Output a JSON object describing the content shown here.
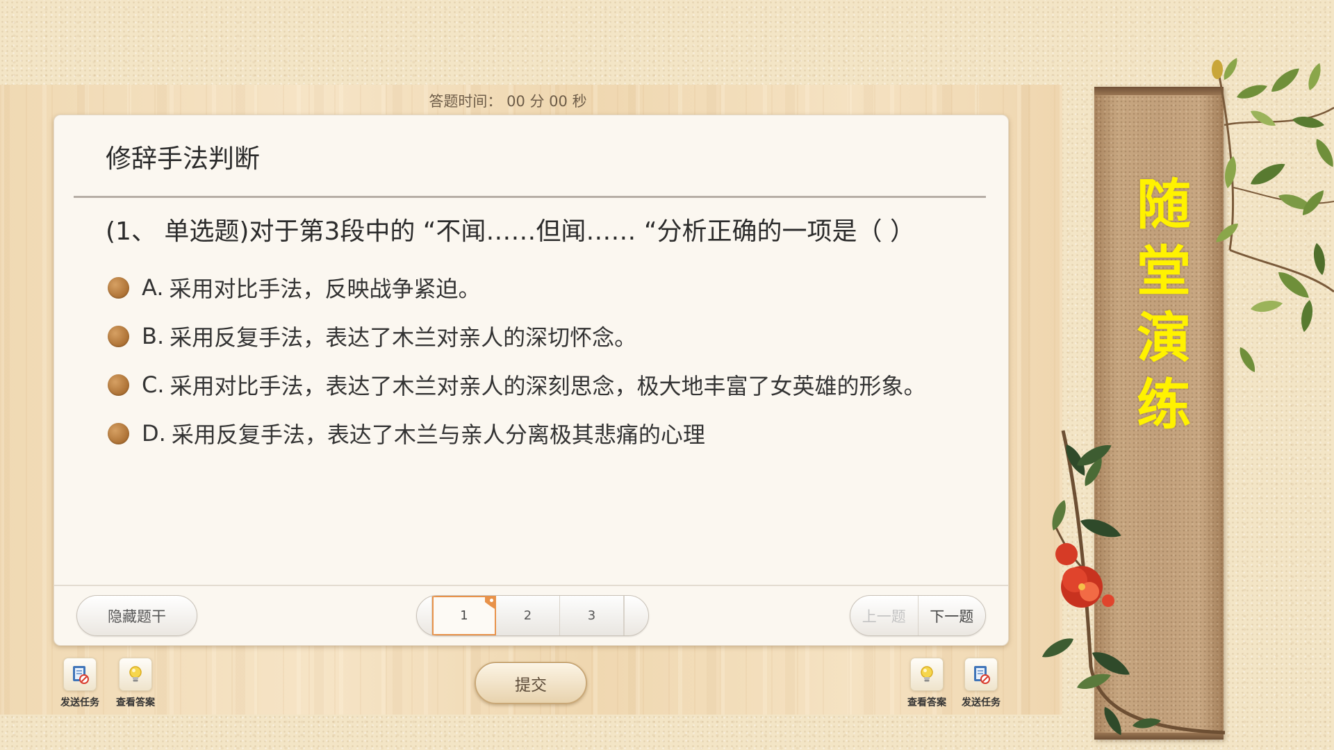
{
  "timer_text": "答题时间： 00 分 00 秒",
  "question": {
    "category": "修辞手法判断",
    "stem": "(1、 单选题)对于第3段中的 “不闻……但闻…… “分析正确的一项是（ ）",
    "options": [
      {
        "letter": "A.",
        "text": "采用对比手法，反映战争紧迫。"
      },
      {
        "letter": "B.",
        "text": "采用反复手法，表达了木兰对亲人的深切怀念。"
      },
      {
        "letter": "C.",
        "text": "采用对比手法，表达了木兰对亲人的深刻思念，极大地丰富了女英雄的形象。"
      },
      {
        "letter": "D.",
        "text": "采用反复手法，表达了木兰与亲人分离极其悲痛的心理"
      }
    ]
  },
  "controls": {
    "hide_stem": "隐藏题干",
    "pages": [
      "1",
      "2",
      "3"
    ],
    "current_page": 1,
    "prev": "上一题",
    "prev_enabled": false,
    "next": "下一题",
    "submit": "提交"
  },
  "toolbar_left": [
    {
      "label": "发送任务",
      "icon": "send-task-icon"
    },
    {
      "label": "查看答案",
      "icon": "view-answer-icon"
    }
  ],
  "toolbar_right": [
    {
      "label": "查看答案",
      "icon": "view-answer-icon"
    },
    {
      "label": "发送任务",
      "icon": "send-task-icon"
    }
  ],
  "banner": {
    "title": "随堂演练",
    "text_color": "#FFF200"
  },
  "colors": {
    "option_bullet": "#B07A3C",
    "active_page_border": "#E8924A",
    "flower": "#E0442C"
  }
}
